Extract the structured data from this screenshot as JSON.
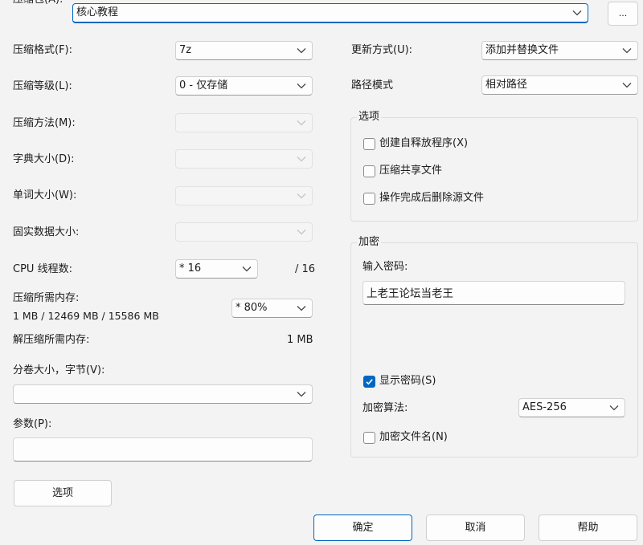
{
  "archive": {
    "label": "压缩包(A):",
    "value": "核心教程",
    "browse_label": "..."
  },
  "left": {
    "format_label": "压缩格式(F):",
    "format_value": "7z",
    "level_label": "压缩等级(L):",
    "level_value": "0 - 仅存储",
    "method_label": "压缩方法(M):",
    "dict_label": "字典大小(D):",
    "word_label": "单词大小(W):",
    "solid_label": "固实数据大小:",
    "cpu_label": "CPU 线程数:",
    "cpu_value": "* 16",
    "cpu_total": "/ 16",
    "mem_label": "压缩所需内存:",
    "mem_detail": "1 MB / 12469 MB / 15586 MB",
    "mem_value": "* 80%",
    "decomp_label": "解压缩所需内存:",
    "decomp_value": "1 MB",
    "split_label": "分卷大小，字节(V):",
    "split_value": "",
    "params_label": "参数(P):",
    "params_value": "",
    "options_button": "选项"
  },
  "right": {
    "update_label": "更新方式(U):",
    "update_value": "添加并替换文件",
    "path_label": "路径模式",
    "path_value": "相对路径",
    "options_group": {
      "title": "选项",
      "sfx_label": "创建自释放程序(X)",
      "sfx_checked": false,
      "shared_label": "压缩共享文件",
      "shared_checked": false,
      "delete_label": "操作完成后删除源文件",
      "delete_checked": false
    },
    "encrypt_group": {
      "title": "加密",
      "password_label": "输入密码:",
      "password_value": "上老王论坛当老王",
      "show_password_label": "显示密码(S)",
      "show_password_checked": true,
      "method_label": "加密算法:",
      "method_value": "AES-256",
      "encrypt_names_label": "加密文件名(N)",
      "encrypt_names_checked": false
    }
  },
  "footer": {
    "ok": "确定",
    "cancel": "取消",
    "help": "帮助"
  },
  "colors": {
    "accent": "#0067c0",
    "background": "#f3f3f3"
  }
}
